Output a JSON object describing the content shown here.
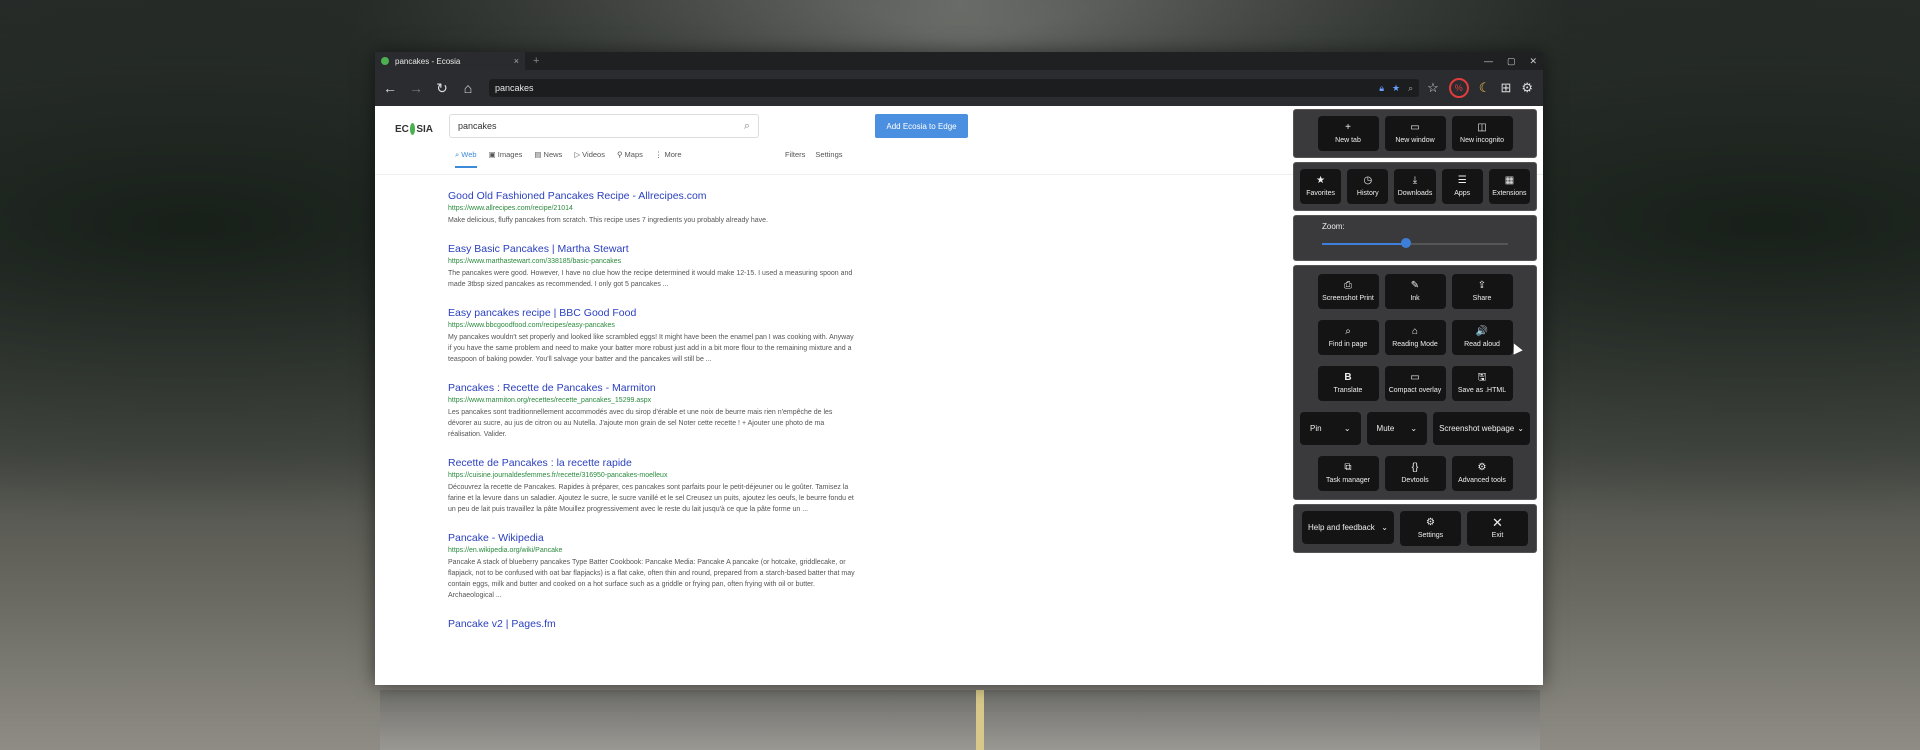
{
  "browser": {
    "tab_title": "pancakes - Ecosia",
    "tab_close": "×",
    "new_tab": "+",
    "window_controls": [
      "—",
      "▢",
      "✕"
    ],
    "url": "pancakes"
  },
  "ecosia": {
    "logo_text_left": "EC",
    "logo_text_right": "SIA",
    "search_value": "pancakes",
    "add_button": "Add Ecosia to Edge",
    "tabs": [
      "Web",
      "Images",
      "News",
      "Videos",
      "Maps",
      "More"
    ],
    "filters": "Filters",
    "settings": "Settings"
  },
  "results": [
    {
      "title": "Good Old Fashioned Pancakes Recipe - Allrecipes.com",
      "url": "https://www.allrecipes.com/recipe/21014",
      "snippet": "Make delicious, fluffy pancakes from scratch. This recipe uses 7 ingredients you probably already have."
    },
    {
      "title": "Easy Basic Pancakes | Martha Stewart",
      "url": "https://www.marthastewart.com/338185/basic-pancakes",
      "snippet": "The pancakes were good. However, I have no clue how the recipe determined it would make 12-15. I used a measuring spoon and made 3tbsp sized pancakes as recommended. I only got 5 pancakes ..."
    },
    {
      "title": "Easy pancakes recipe | BBC Good Food",
      "url": "https://www.bbcgoodfood.com/recipes/easy-pancakes",
      "snippet": "My pancakes wouldn't set properly and looked like scrambled eggs! It might have been the enamel pan I was cooking with. Anyway if you have the same problem and need to make your batter more robust just add in a bit more flour to the remaining mixture and a teaspoon of baking powder. You'll salvage your batter and the pancakes will still be ..."
    },
    {
      "title": "Pancakes : Recette de Pancakes - Marmiton",
      "url": "https://www.marmiton.org/recettes/recette_pancakes_15299.aspx",
      "snippet": "Les pancakes sont traditionnellement accommodés avec du sirop d'érable et une noix de beurre mais rien n'empêche de les dévorer au sucre, au jus de citron ou au Nutella. J'ajoute mon grain de sel Noter cette recette ! + Ajouter une photo de ma réalisation. Valider."
    },
    {
      "title": "Recette de Pancakes : la recette rapide",
      "url": "https://cuisine.journaldesfemmes.fr/recette/316950-pancakes-moelleux",
      "snippet": "Découvrez la recette de Pancakes. Rapides à préparer, ces pancakes sont parfaits pour le petit-déjeuner ou le goûter. Tamisez la farine et la levure dans un saladier. Ajoutez le sucre, le sucre vanillé et le sel Creusez un puits, ajoutez les oeufs, le beurre fondu et un peu de lait puis travaillez la pâte Mouillez progressivement avec le reste du lait jusqu'à ce que la pâte forme un ..."
    },
    {
      "title": "Pancake - Wikipedia",
      "url": "https://en.wikipedia.org/wiki/Pancake",
      "snippet": "Pancake A stack of blueberry pancakes Type Batter Cookbook: Pancake Media: Pancake A pancake (or hotcake, griddlecake, or flapjack, not to be confused with oat bar flapjacks) is a flat cake, often thin and round, prepared from a starch-based batter that may contain eggs, milk and butter and cooked on a hot surface such as a griddle or frying pan, often frying with oil or butter. Archaeological ..."
    },
    {
      "title": "Pancake v2 | Pages.fm",
      "url": "",
      "snippet": ""
    }
  ],
  "menu": {
    "row1": [
      {
        "icon": "+",
        "label": "New tab"
      },
      {
        "icon": "▭",
        "label": "New window"
      },
      {
        "icon": "◫",
        "label": "New incognito"
      }
    ],
    "row2": [
      {
        "icon": "★",
        "label": "Favorites"
      },
      {
        "icon": "◷",
        "label": "History"
      },
      {
        "icon": "⤓",
        "label": "Downloads"
      },
      {
        "icon": "☰",
        "label": "Apps"
      },
      {
        "icon": "▦",
        "label": "Extensions"
      }
    ],
    "zoom_label": "Zoom:",
    "zoom_level": 0.45,
    "row3": [
      {
        "icon": "⎙",
        "label": "Screenshot Print"
      },
      {
        "icon": "✎",
        "label": "Ink"
      },
      {
        "icon": "⇪",
        "label": "Share"
      }
    ],
    "row4": [
      {
        "icon": "⌕",
        "label": "Find in page"
      },
      {
        "icon": "⌂",
        "label": "Reading Mode"
      },
      {
        "icon": "🔊",
        "label": "Read aloud"
      }
    ],
    "row5": [
      {
        "icon": "B",
        "label": "Translate"
      },
      {
        "icon": "▭",
        "label": "Compact overlay"
      },
      {
        "icon": "🖫",
        "label": "Save as .HTML"
      }
    ],
    "dropdowns": [
      "Pin",
      "Mute",
      "Screenshot webpage"
    ],
    "row6": [
      {
        "icon": "⧉",
        "label": "Task manager"
      },
      {
        "icon": "{}",
        "label": "Devtools"
      },
      {
        "icon": "⚙",
        "label": "Advanced tools"
      }
    ],
    "help": "Help and feedback",
    "settings": {
      "icon": "⚙",
      "label": "Settings"
    },
    "exit": {
      "icon": "✕",
      "label": "Exit"
    }
  }
}
